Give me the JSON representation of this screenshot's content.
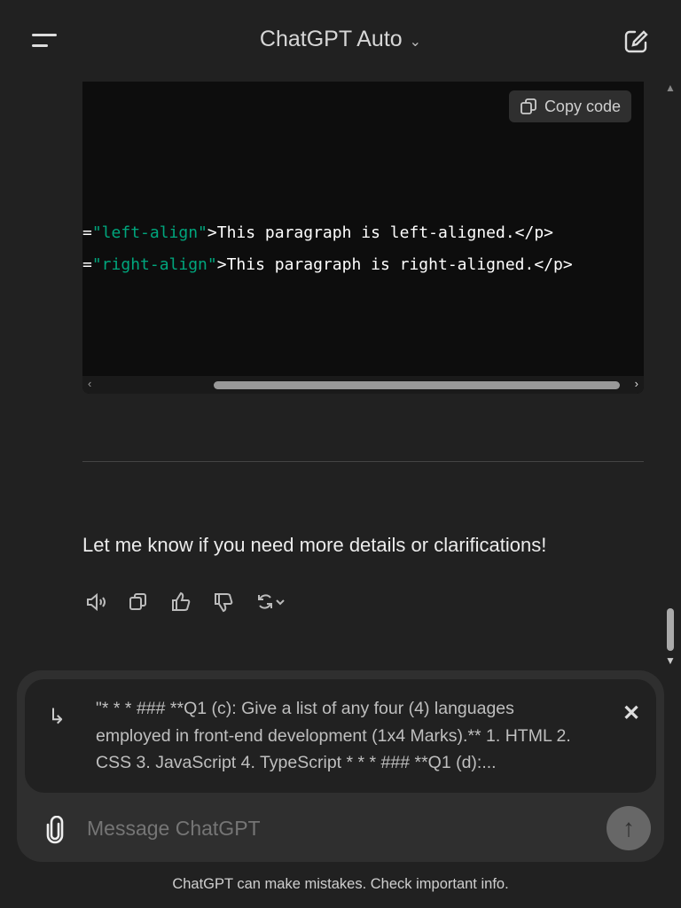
{
  "header": {
    "title": "ChatGPT Auto",
    "chevron": "⌄"
  },
  "code_block": {
    "copy_label": "Copy code",
    "lines": [
      {
        "pre": "=",
        "str": "\"left-align\"",
        "post": ">This paragraph is left-aligned.</p>"
      },
      {
        "pre": "=",
        "str": "\"right-align\"",
        "post": ">This paragraph is right-aligned.</p>"
      }
    ]
  },
  "message": {
    "text": "Let me know if you need more details or clarifications!"
  },
  "composer": {
    "quote": "\"* * * ### **Q1 (c): Give a list of any four (4) languages employed in front-end development (1x4 Marks).** 1. HTML 2. CSS 3. JavaScript 4. TypeScript * * * ### **Q1 (d):...",
    "placeholder": "Message ChatGPT"
  },
  "footer": "ChatGPT can make mistakes. Check important info."
}
